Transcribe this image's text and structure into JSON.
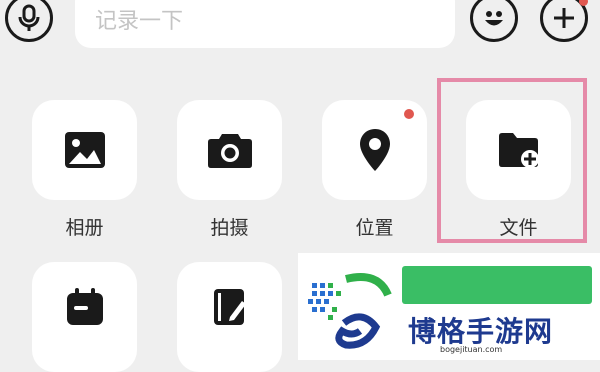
{
  "search": {
    "placeholder": "记录一下",
    "value": ""
  },
  "toolbar": {
    "voice": {
      "icon": "microphone-icon"
    },
    "emoji": {
      "icon": "emoji-icon"
    },
    "add": {
      "icon": "plus-icon",
      "has_badge": true
    }
  },
  "attachments": [
    {
      "label": "相册",
      "icon": "photo-icon"
    },
    {
      "label": "拍摄",
      "icon": "camera-icon"
    },
    {
      "label": "位置",
      "icon": "location-pin-icon",
      "has_badge": true
    },
    {
      "label": "文件",
      "icon": "folder-add-icon",
      "highlighted": true
    },
    {
      "label": "",
      "icon": "calendar-icon"
    },
    {
      "label": "",
      "icon": "notebook-edit-icon"
    }
  ],
  "watermark": {
    "name": "博格手游网",
    "url": "bogejituan.com"
  },
  "colors": {
    "background": "#efefef",
    "tile": "#ffffff",
    "icon": "#1a1a1a",
    "badge": "#e0574f",
    "highlight": "#e58aa8",
    "watermark_blue": "#1e3a8f",
    "watermark_green": "#18b34a"
  }
}
